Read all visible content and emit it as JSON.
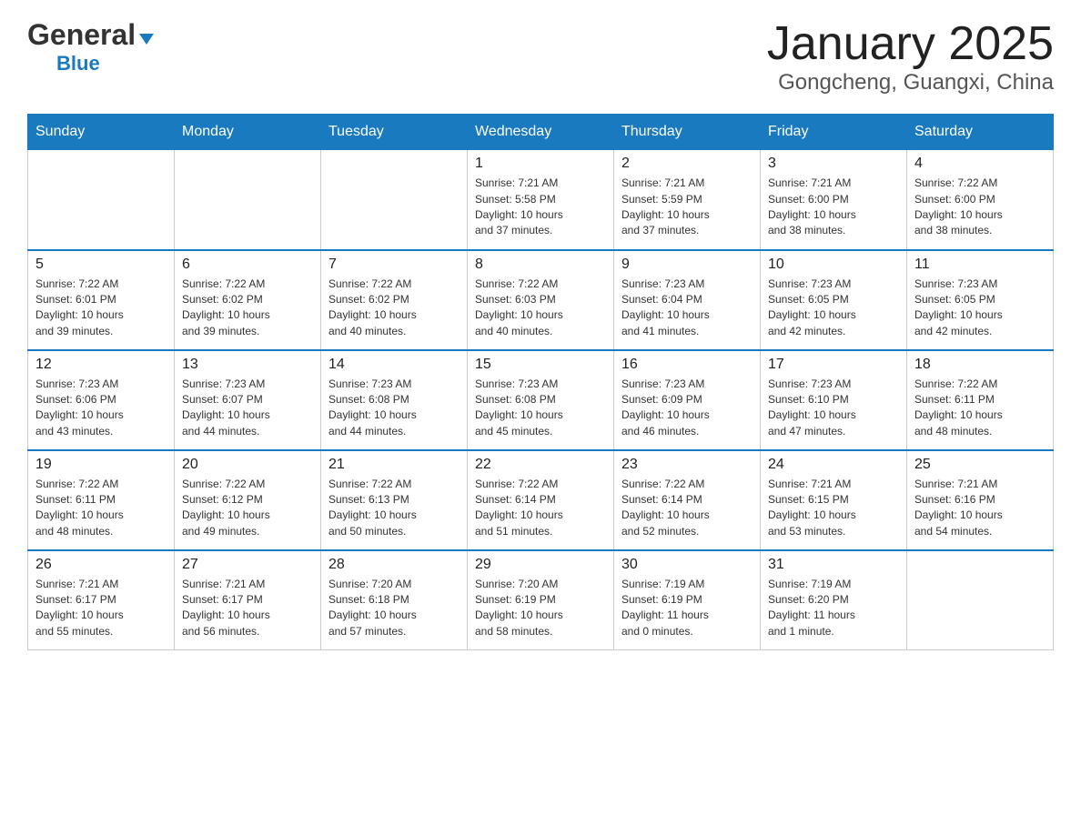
{
  "logo": {
    "general": "General",
    "blue": "Blue"
  },
  "header": {
    "month": "January 2025",
    "location": "Gongcheng, Guangxi, China"
  },
  "weekdays": [
    "Sunday",
    "Monday",
    "Tuesday",
    "Wednesday",
    "Thursday",
    "Friday",
    "Saturday"
  ],
  "weeks": [
    [
      {
        "day": "",
        "info": ""
      },
      {
        "day": "",
        "info": ""
      },
      {
        "day": "",
        "info": ""
      },
      {
        "day": "1",
        "info": "Sunrise: 7:21 AM\nSunset: 5:58 PM\nDaylight: 10 hours\nand 37 minutes."
      },
      {
        "day": "2",
        "info": "Sunrise: 7:21 AM\nSunset: 5:59 PM\nDaylight: 10 hours\nand 37 minutes."
      },
      {
        "day": "3",
        "info": "Sunrise: 7:21 AM\nSunset: 6:00 PM\nDaylight: 10 hours\nand 38 minutes."
      },
      {
        "day": "4",
        "info": "Sunrise: 7:22 AM\nSunset: 6:00 PM\nDaylight: 10 hours\nand 38 minutes."
      }
    ],
    [
      {
        "day": "5",
        "info": "Sunrise: 7:22 AM\nSunset: 6:01 PM\nDaylight: 10 hours\nand 39 minutes."
      },
      {
        "day": "6",
        "info": "Sunrise: 7:22 AM\nSunset: 6:02 PM\nDaylight: 10 hours\nand 39 minutes."
      },
      {
        "day": "7",
        "info": "Sunrise: 7:22 AM\nSunset: 6:02 PM\nDaylight: 10 hours\nand 40 minutes."
      },
      {
        "day": "8",
        "info": "Sunrise: 7:22 AM\nSunset: 6:03 PM\nDaylight: 10 hours\nand 40 minutes."
      },
      {
        "day": "9",
        "info": "Sunrise: 7:23 AM\nSunset: 6:04 PM\nDaylight: 10 hours\nand 41 minutes."
      },
      {
        "day": "10",
        "info": "Sunrise: 7:23 AM\nSunset: 6:05 PM\nDaylight: 10 hours\nand 42 minutes."
      },
      {
        "day": "11",
        "info": "Sunrise: 7:23 AM\nSunset: 6:05 PM\nDaylight: 10 hours\nand 42 minutes."
      }
    ],
    [
      {
        "day": "12",
        "info": "Sunrise: 7:23 AM\nSunset: 6:06 PM\nDaylight: 10 hours\nand 43 minutes."
      },
      {
        "day": "13",
        "info": "Sunrise: 7:23 AM\nSunset: 6:07 PM\nDaylight: 10 hours\nand 44 minutes."
      },
      {
        "day": "14",
        "info": "Sunrise: 7:23 AM\nSunset: 6:08 PM\nDaylight: 10 hours\nand 44 minutes."
      },
      {
        "day": "15",
        "info": "Sunrise: 7:23 AM\nSunset: 6:08 PM\nDaylight: 10 hours\nand 45 minutes."
      },
      {
        "day": "16",
        "info": "Sunrise: 7:23 AM\nSunset: 6:09 PM\nDaylight: 10 hours\nand 46 minutes."
      },
      {
        "day": "17",
        "info": "Sunrise: 7:23 AM\nSunset: 6:10 PM\nDaylight: 10 hours\nand 47 minutes."
      },
      {
        "day": "18",
        "info": "Sunrise: 7:22 AM\nSunset: 6:11 PM\nDaylight: 10 hours\nand 48 minutes."
      }
    ],
    [
      {
        "day": "19",
        "info": "Sunrise: 7:22 AM\nSunset: 6:11 PM\nDaylight: 10 hours\nand 48 minutes."
      },
      {
        "day": "20",
        "info": "Sunrise: 7:22 AM\nSunset: 6:12 PM\nDaylight: 10 hours\nand 49 minutes."
      },
      {
        "day": "21",
        "info": "Sunrise: 7:22 AM\nSunset: 6:13 PM\nDaylight: 10 hours\nand 50 minutes."
      },
      {
        "day": "22",
        "info": "Sunrise: 7:22 AM\nSunset: 6:14 PM\nDaylight: 10 hours\nand 51 minutes."
      },
      {
        "day": "23",
        "info": "Sunrise: 7:22 AM\nSunset: 6:14 PM\nDaylight: 10 hours\nand 52 minutes."
      },
      {
        "day": "24",
        "info": "Sunrise: 7:21 AM\nSunset: 6:15 PM\nDaylight: 10 hours\nand 53 minutes."
      },
      {
        "day": "25",
        "info": "Sunrise: 7:21 AM\nSunset: 6:16 PM\nDaylight: 10 hours\nand 54 minutes."
      }
    ],
    [
      {
        "day": "26",
        "info": "Sunrise: 7:21 AM\nSunset: 6:17 PM\nDaylight: 10 hours\nand 55 minutes."
      },
      {
        "day": "27",
        "info": "Sunrise: 7:21 AM\nSunset: 6:17 PM\nDaylight: 10 hours\nand 56 minutes."
      },
      {
        "day": "28",
        "info": "Sunrise: 7:20 AM\nSunset: 6:18 PM\nDaylight: 10 hours\nand 57 minutes."
      },
      {
        "day": "29",
        "info": "Sunrise: 7:20 AM\nSunset: 6:19 PM\nDaylight: 10 hours\nand 58 minutes."
      },
      {
        "day": "30",
        "info": "Sunrise: 7:19 AM\nSunset: 6:19 PM\nDaylight: 11 hours\nand 0 minutes."
      },
      {
        "day": "31",
        "info": "Sunrise: 7:19 AM\nSunset: 6:20 PM\nDaylight: 11 hours\nand 1 minute."
      },
      {
        "day": "",
        "info": ""
      }
    ]
  ]
}
